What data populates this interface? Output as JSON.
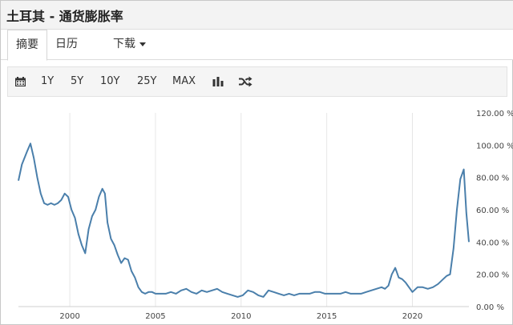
{
  "title": "土耳其 - 通货膨胀率",
  "tabs": [
    {
      "label": "摘要",
      "active": true
    },
    {
      "label": "日历",
      "active": false
    },
    {
      "label": "下载",
      "active": false
    }
  ],
  "toolbar": {
    "calendar_icon": "calendar-icon",
    "ranges": [
      "1Y",
      "5Y",
      "10Y",
      "25Y",
      "MAX"
    ],
    "chart_type_icon": "bar-chart-icon",
    "compare_icon": "shuffle-icon"
  },
  "colors": {
    "line": "#4a7fab",
    "grid": "#e6e6e6",
    "axis_text": "#444444"
  },
  "chart_data": {
    "type": "line",
    "title": "",
    "xlabel": "",
    "ylabel": "",
    "xlim": [
      1997.0,
      2023.3
    ],
    "ylim": [
      0,
      120
    ],
    "y_ticks": [
      0,
      20,
      40,
      60,
      80,
      100,
      120
    ],
    "y_tick_labels": [
      "0.00 %",
      "20.00 %",
      "40.00 %",
      "60.00 %",
      "80.00 %",
      "100.00 %",
      "120.00 %"
    ],
    "x_ticks": [
      2000,
      2005,
      2010,
      2015,
      2020
    ],
    "x_tick_labels": [
      "2000",
      "2005",
      "2010",
      "2015",
      "2020"
    ],
    "grid": "vertical",
    "series": [
      {
        "name": "",
        "x": [
          1997.0,
          1997.2,
          1997.5,
          1997.7,
          1997.9,
          1998.1,
          1998.3,
          1998.5,
          1998.7,
          1998.9,
          1999.1,
          1999.3,
          1999.5,
          1999.7,
          1999.9,
          2000.1,
          2000.3,
          2000.5,
          2000.7,
          2000.9,
          2001.1,
          2001.3,
          2001.5,
          2001.7,
          2001.9,
          2002.05,
          2002.2,
          2002.4,
          2002.6,
          2002.8,
          2003.0,
          2003.2,
          2003.4,
          2003.6,
          2003.8,
          2004.0,
          2004.2,
          2004.4,
          2004.6,
          2004.8,
          2005.0,
          2005.3,
          2005.6,
          2005.9,
          2006.2,
          2006.5,
          2006.8,
          2007.1,
          2007.4,
          2007.7,
          2008.0,
          2008.3,
          2008.6,
          2008.9,
          2009.2,
          2009.5,
          2009.8,
          2010.1,
          2010.4,
          2010.7,
          2011.0,
          2011.3,
          2011.6,
          2011.9,
          2012.2,
          2012.5,
          2012.8,
          2013.1,
          2013.4,
          2013.7,
          2014.0,
          2014.3,
          2014.6,
          2014.9,
          2015.2,
          2015.5,
          2015.8,
          2016.1,
          2016.4,
          2016.7,
          2017.0,
          2017.3,
          2017.6,
          2017.9,
          2018.2,
          2018.4,
          2018.6,
          2018.8,
          2019.0,
          2019.2,
          2019.4,
          2019.6,
          2019.8,
          2020.0,
          2020.3,
          2020.6,
          2020.9,
          2021.2,
          2021.5,
          2021.8,
          2022.0,
          2022.2,
          2022.4,
          2022.6,
          2022.8,
          2022.9,
          2023.0,
          2023.15,
          2023.3
        ],
        "values": [
          78,
          88,
          96,
          101,
          92,
          80,
          70,
          64,
          63,
          64,
          63,
          64,
          66,
          70,
          68,
          60,
          55,
          45,
          38,
          33,
          48,
          56,
          60,
          68,
          73,
          70,
          52,
          42,
          38,
          32,
          27,
          30,
          29,
          22,
          18,
          12,
          9,
          8,
          9,
          9,
          8,
          8,
          8,
          9,
          8,
          10,
          11,
          9,
          8,
          10,
          9,
          10,
          11,
          9,
          8,
          7,
          6,
          7,
          10,
          9,
          7,
          6,
          10,
          9,
          8,
          7,
          8,
          7,
          8,
          8,
          8,
          9,
          9,
          8,
          8,
          8,
          8,
          9,
          8,
          8,
          8,
          9,
          10,
          11,
          12,
          11,
          13,
          20,
          24,
          18,
          17,
          15,
          12,
          9,
          12,
          12,
          11,
          12,
          14,
          17,
          19,
          20,
          36,
          60,
          79,
          82,
          85,
          58,
          40
        ]
      }
    ]
  }
}
